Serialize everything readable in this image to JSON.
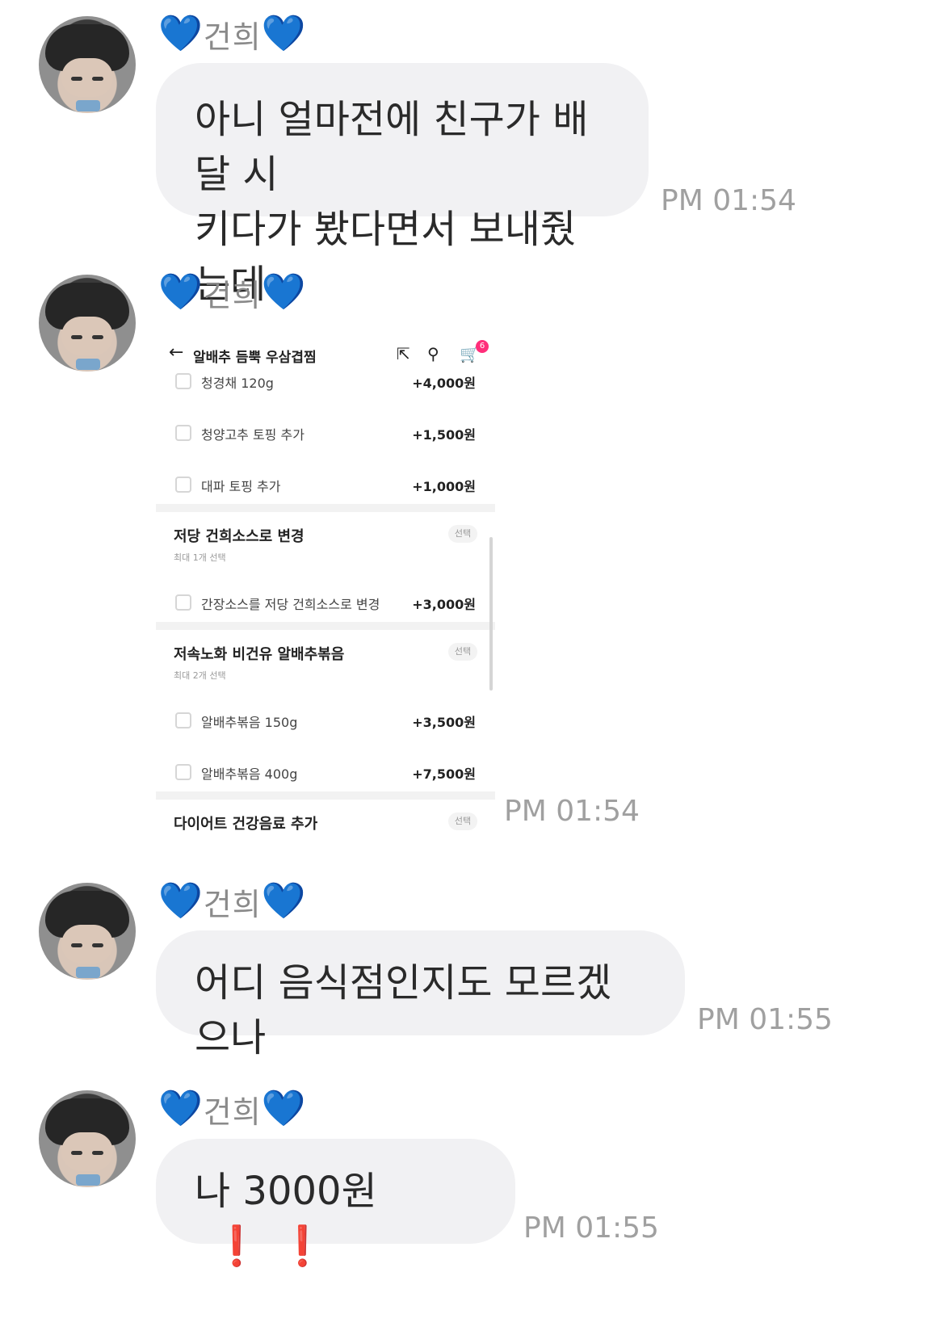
{
  "messages": [
    {
      "sender": "건희",
      "type": "text",
      "lines": [
        "아니 얼마전에 친구가 배달 시",
        "키다가 봤다면서 보내줬는데"
      ],
      "time": "PM 01:54"
    },
    {
      "sender": "건희",
      "type": "image",
      "time": "PM 01:54"
    },
    {
      "sender": "건희",
      "type": "text",
      "lines": [
        "어디 음식점인지도 모르겠으나"
      ],
      "time": "PM 01:55"
    },
    {
      "sender": "건희",
      "type": "text",
      "text": "나 3000원",
      "emoji": [
        "❗",
        "❗"
      ],
      "time": "PM 01:55"
    }
  ],
  "shared_screenshot": {
    "title": "알배추 듬뿍 우삼겹찜",
    "cart_count": "6",
    "icons": [
      "back-arrow-icon",
      "share-icon",
      "search-icon",
      "cart-icon"
    ],
    "rows_top": [
      {
        "label": "청경채 120g",
        "price": "+4,000원"
      },
      {
        "label": "청양고추 토핑 추가",
        "price": "+1,500원"
      },
      {
        "label": "대파 토핑 추가",
        "price": "+1,000원"
      }
    ],
    "sections": [
      {
        "title": "저당 건희소스로 변경",
        "subtitle": "최대 1개 선택",
        "pill": "선택",
        "rows": [
          {
            "label": "간장소스를 저당 건희소스로 변경",
            "price": "+3,000원"
          }
        ]
      },
      {
        "title": "저속노화 비건유 알배추볶음",
        "subtitle": "최대 2개 선택",
        "pill": "선택",
        "rows": [
          {
            "label": "알배추볶음 150g",
            "price": "+3,500원"
          },
          {
            "label": "알배추볶음 400g",
            "price": "+7,500원"
          }
        ]
      },
      {
        "title": "다이어트 건강음료 추가",
        "pill": "선택"
      }
    ]
  }
}
